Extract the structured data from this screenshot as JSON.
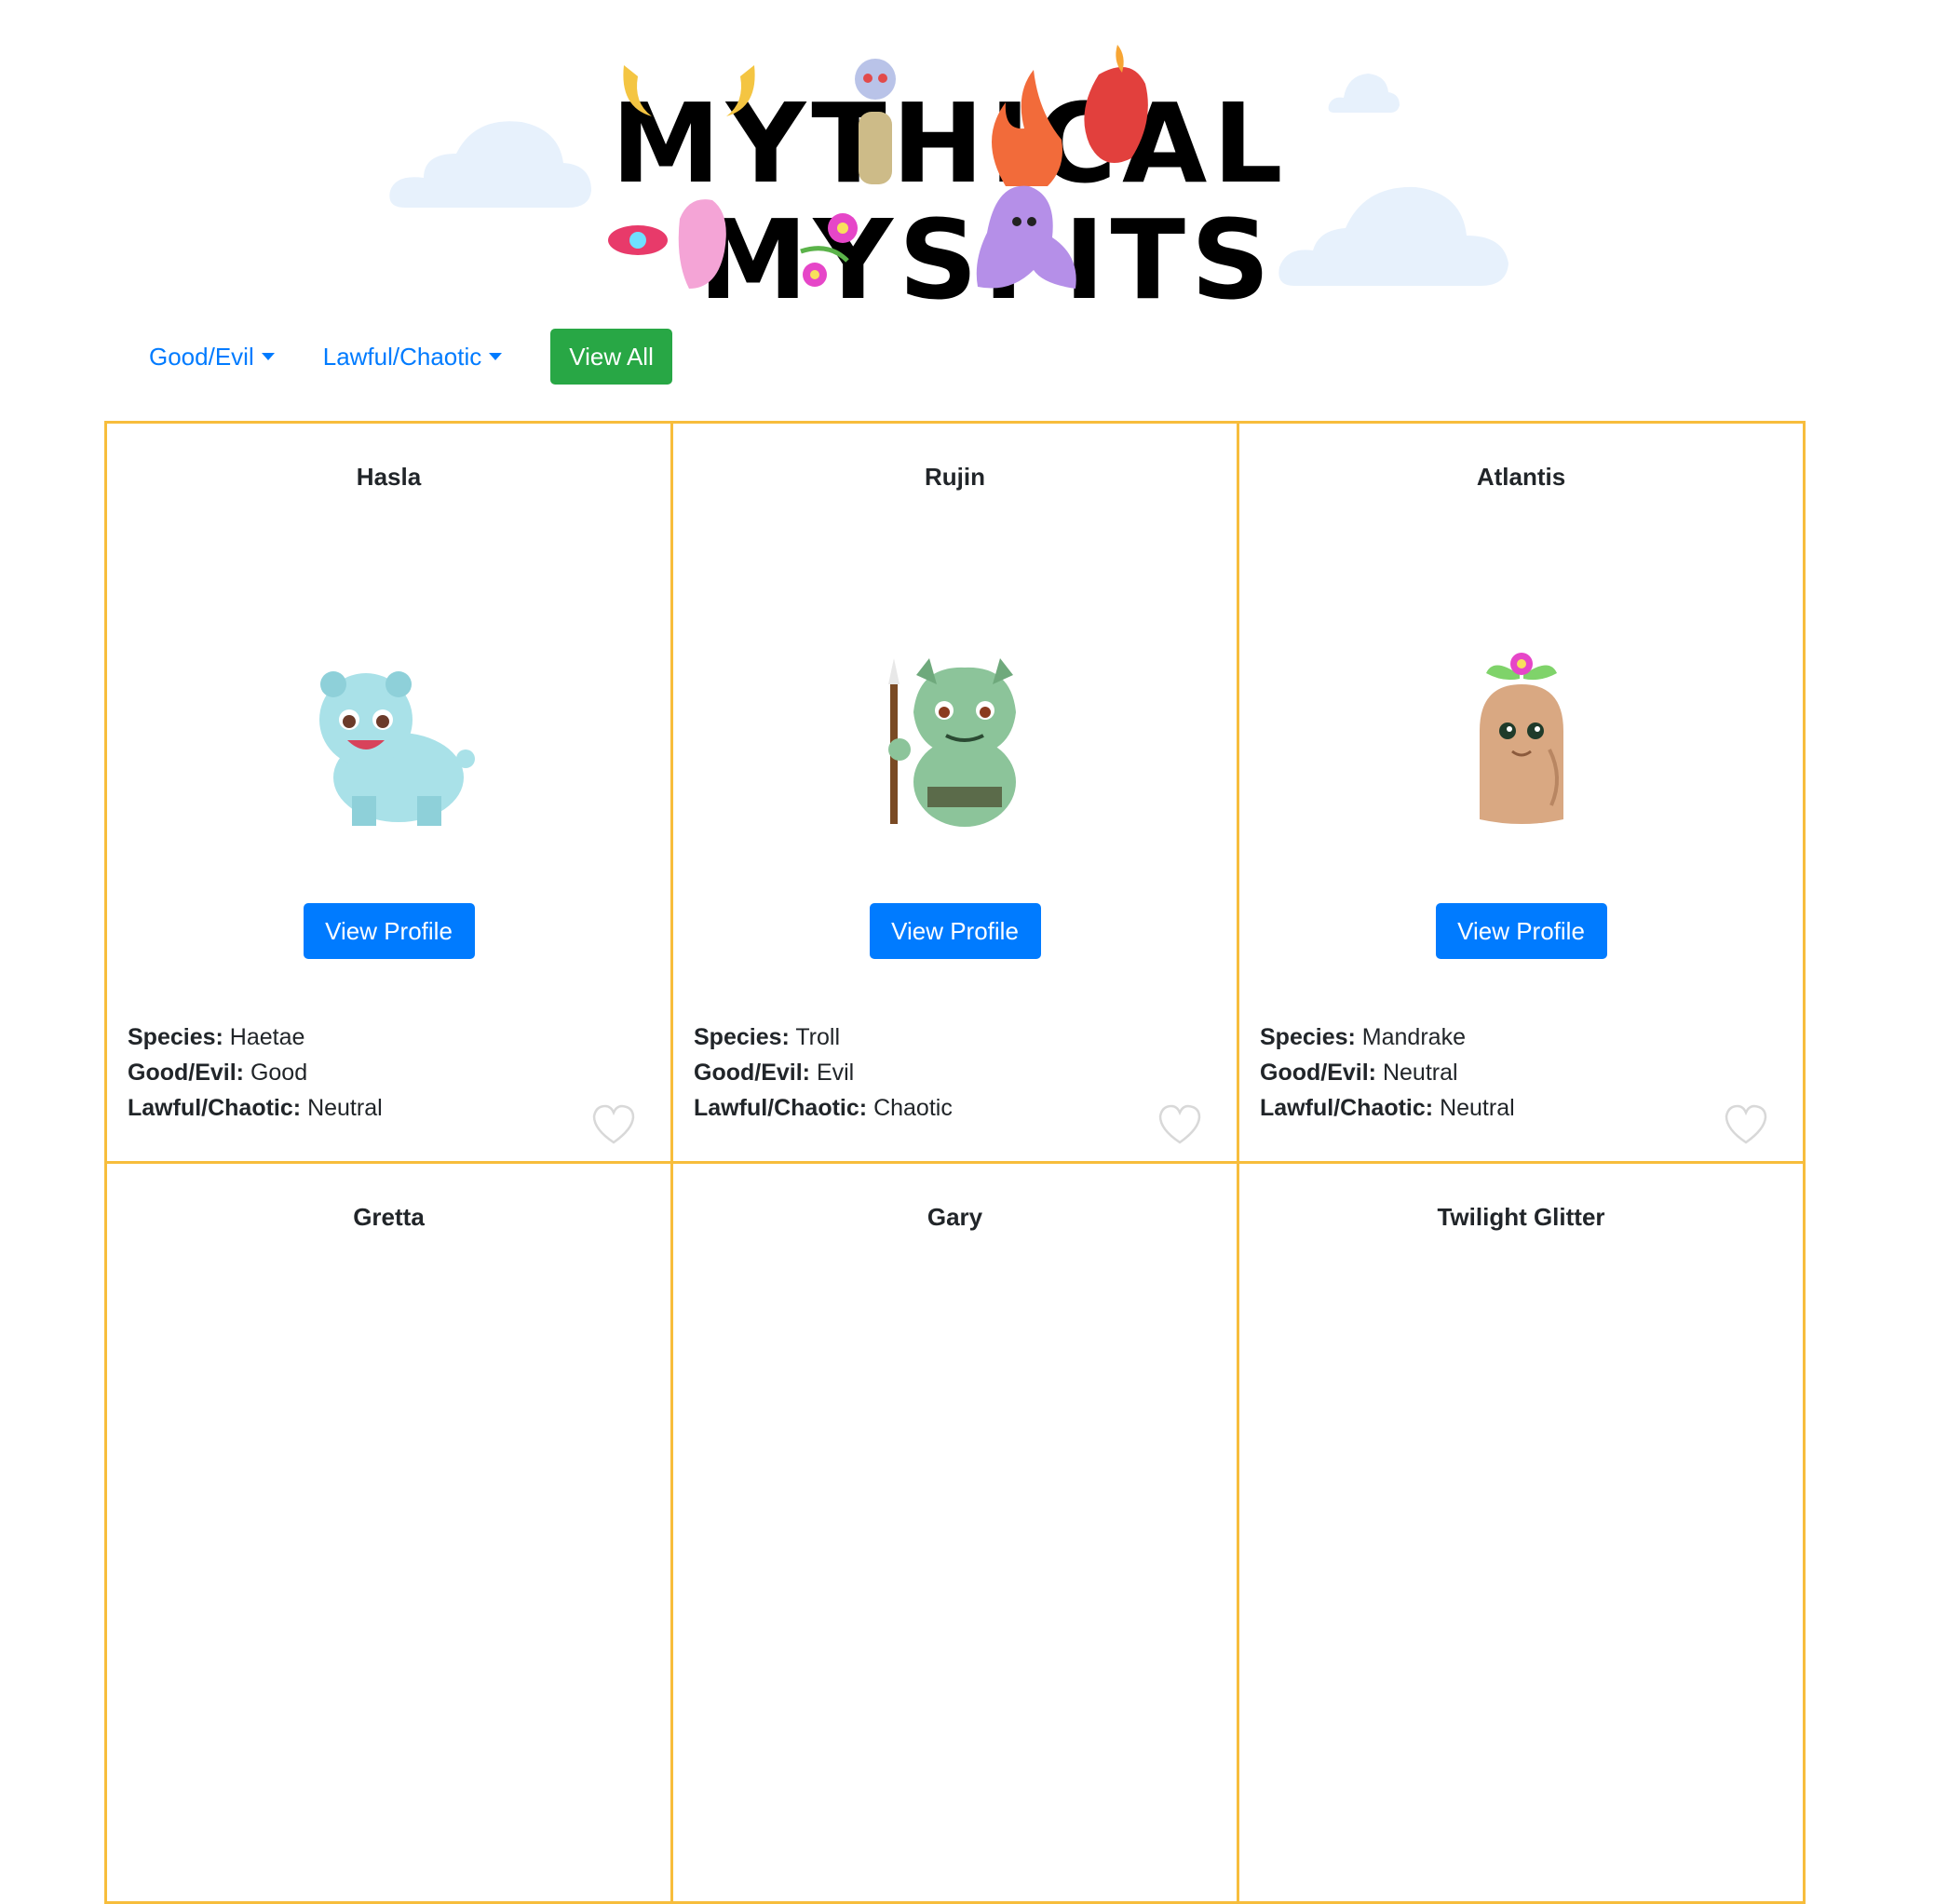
{
  "header": {
    "logo_line1": "MYTHICAL",
    "logo_line2": "MYSFITS"
  },
  "filters": {
    "good_evil_label": "Good/Evil",
    "lawful_chaotic_label": "Lawful/Chaotic",
    "view_all_label": "View All"
  },
  "labels": {
    "species": "Species:",
    "good_evil": "Good/Evil:",
    "lawful_chaotic": "Lawful/Chaotic:",
    "view_profile": "View Profile"
  },
  "mysfits": [
    {
      "name": "Hasla",
      "species": "Haetae",
      "good_evil": "Good",
      "lawful_chaotic": "Neutral",
      "icon": "hasla-haetae-icon",
      "color": "#a9e1e8"
    },
    {
      "name": "Rujin",
      "species": "Troll",
      "good_evil": "Evil",
      "lawful_chaotic": "Chaotic",
      "icon": "rujin-troll-icon",
      "color": "#8cc49a"
    },
    {
      "name": "Atlantis",
      "species": "Mandrake",
      "good_evil": "Neutral",
      "lawful_chaotic": "Neutral",
      "icon": "atlantis-mandrake-icon",
      "color": "#d9a882"
    },
    {
      "name": "Gretta"
    },
    {
      "name": "Gary"
    },
    {
      "name": "Twilight Glitter"
    }
  ],
  "colors": {
    "card_border": "#f7bd3c",
    "primary": "#007bff",
    "success": "#28a745"
  }
}
